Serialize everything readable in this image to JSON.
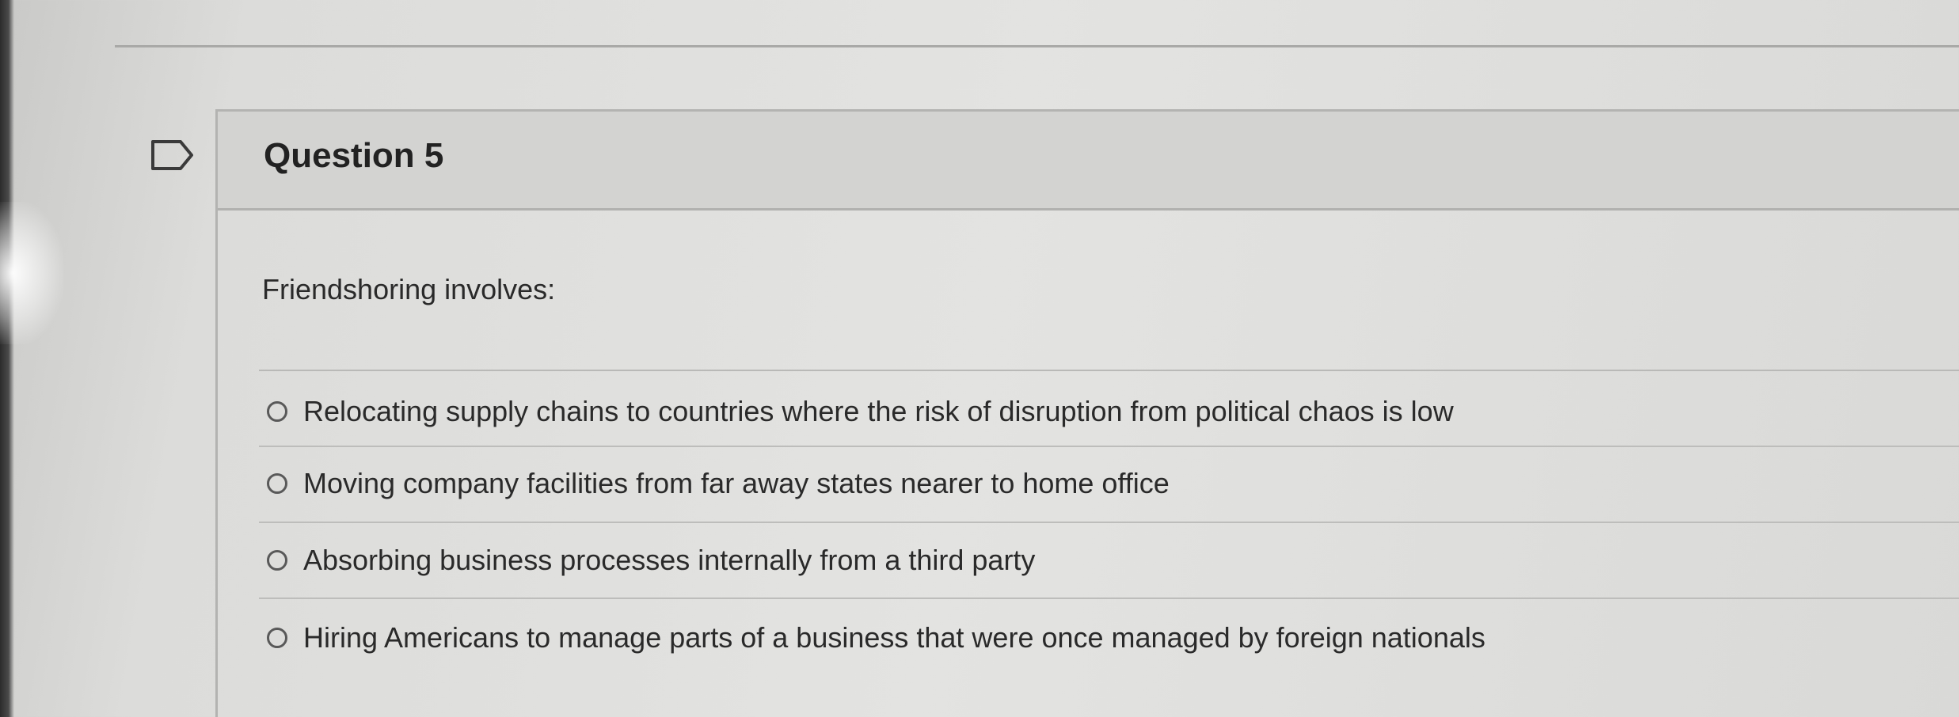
{
  "question": {
    "title": "Question 5",
    "prompt": "Friendshoring involves:",
    "options": [
      {
        "label": "Relocating supply chains to countries where the risk of disruption from political chaos is low"
      },
      {
        "label": "Moving company facilities from far away states nearer to home office"
      },
      {
        "label": "Absorbing business processes internally from a third party"
      },
      {
        "label": "Hiring Americans to manage parts of a business that were once managed by foreign nationals"
      }
    ]
  },
  "icons": {
    "flag": "flag-icon",
    "radio": "radio-unchecked-icon"
  },
  "colors": {
    "header_bg": "#d3d3d1",
    "page_bg": "#e0e0de",
    "text": "#262626"
  }
}
